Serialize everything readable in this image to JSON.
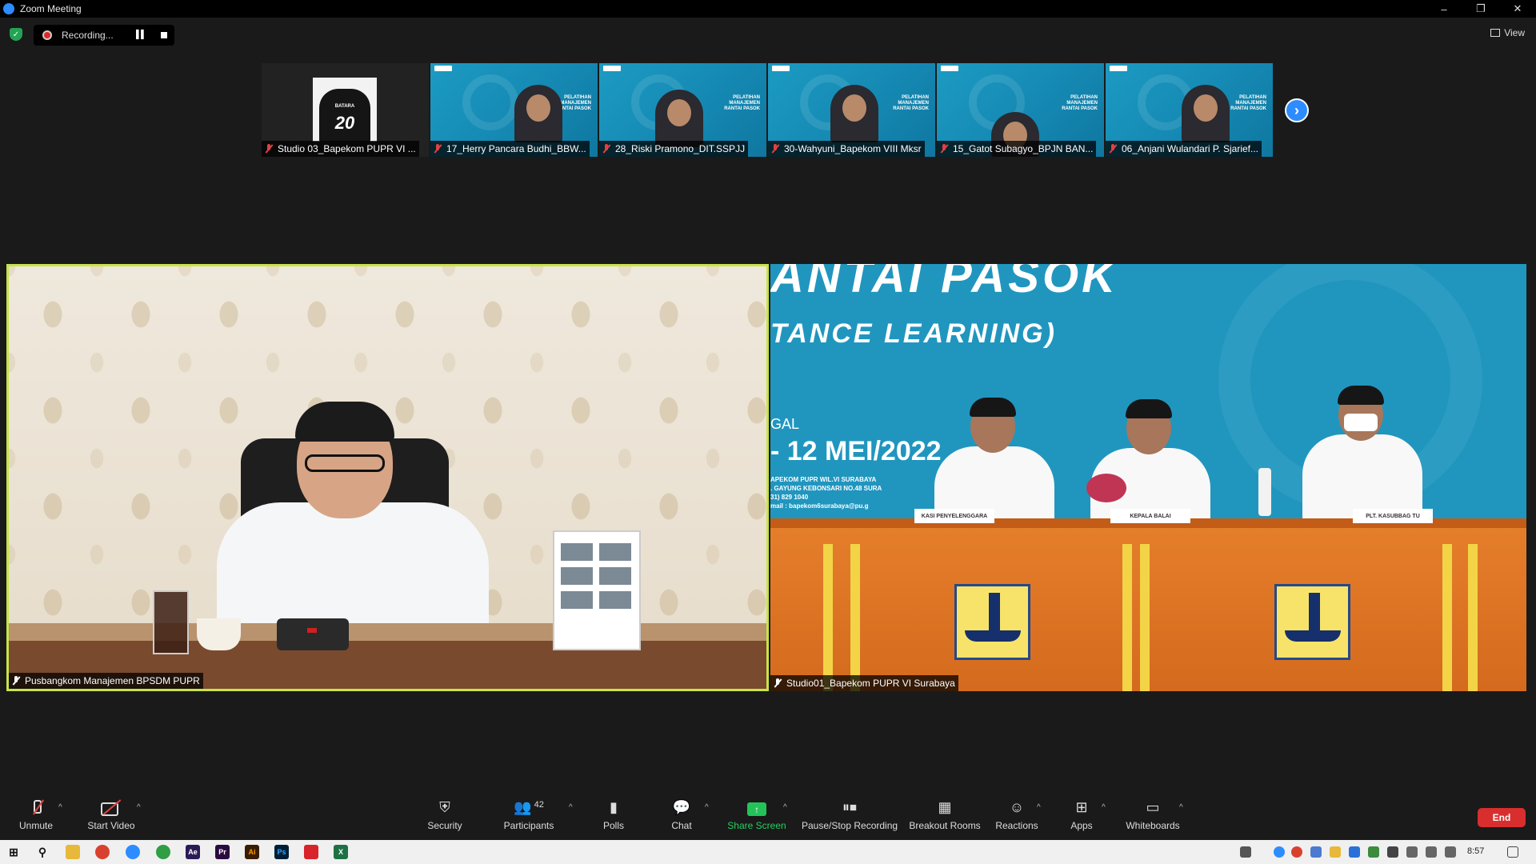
{
  "window": {
    "title": "Zoom Meeting",
    "controls": [
      "–",
      "❐",
      "✕"
    ]
  },
  "topbar": {
    "recording_text": "Recording...",
    "view_label": "View"
  },
  "thumbnails": [
    {
      "name": "Studio 03_Bapekom PUPR VI ...",
      "kind": "jersey",
      "jersey_team": "BATARA",
      "jersey_number": "20"
    },
    {
      "name": "17_Herry Pancara Budhi_BBW...",
      "kind": "blue"
    },
    {
      "name": "28_Riski Pramono_DIT.SSPJJ",
      "kind": "blue"
    },
    {
      "name": "30-Wahyuni_Bapekom VIII Mksr",
      "kind": "blue"
    },
    {
      "name": "15_Gatot Subagyo_BPJN BAN...",
      "kind": "blue"
    },
    {
      "name": "06_Anjani Wulandari P. Sjarief...",
      "kind": "blue"
    }
  ],
  "thumb_slogan": "PELATIHAN MANAJEMEN RANTAI PASOK",
  "main_videos": {
    "left": {
      "name": "Pusbangkom Manajemen BPSDM PUPR"
    },
    "right": {
      "name": "Studio01_Bapekom PUPR VI Surabaya",
      "banner_title": "ANTAI PASOK",
      "banner_sub": "TANCE  LEARNING)",
      "date_label": "GAL",
      "date": "- 12 MEI/2022",
      "address": [
        "APEKOM PUPR WIL.VI SURABAYA",
        ". GAYUNG KEBONSARI NO.48 SURA",
        "31) 829 1040",
        "mail : bapekom6surabaya@pu.g"
      ],
      "nameplates": [
        "KASI PENYELENGGARA",
        "KEPALA BALAI",
        "PLT. KASUBBAG TU"
      ]
    }
  },
  "toolbar": {
    "unmute": "Unmute",
    "start_video": "Start Video",
    "security": "Security",
    "participants": "Participants",
    "participants_count": "42",
    "polls": "Polls",
    "chat": "Chat",
    "share_screen": "Share Screen",
    "recording": "Pause/Stop Recording",
    "breakout": "Breakout Rooms",
    "reactions": "Reactions",
    "apps": "Apps",
    "whiteboards": "Whiteboards",
    "end": "End"
  },
  "taskbar": {
    "time": "8:57"
  },
  "colors": {
    "active_speaker_border": "#c8e34a",
    "share_green": "#23c35a",
    "end_red": "#d82e2e",
    "zoom_blue": "#2d8cff"
  }
}
